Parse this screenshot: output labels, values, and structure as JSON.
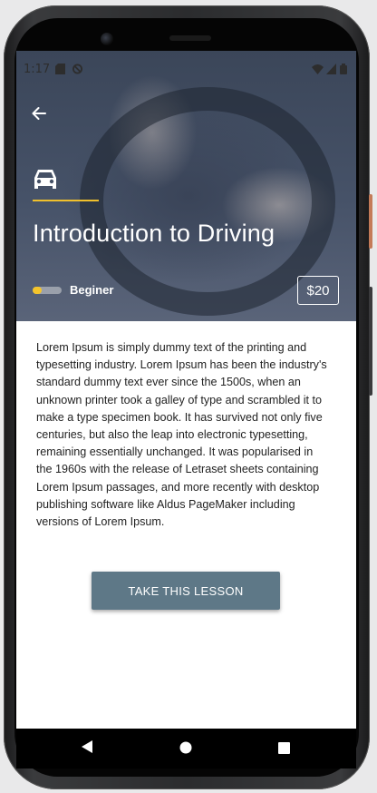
{
  "status_bar": {
    "time": "1:17",
    "icons": [
      "sd-card-icon",
      "do-not-disturb-icon",
      "wifi-icon",
      "signal-icon",
      "battery-icon"
    ]
  },
  "lesson": {
    "icon": "car-icon",
    "title": "Introduction to Driving",
    "level_label": "Beginer",
    "level_fraction": 0.3,
    "price": "$20",
    "description": "Lorem Ipsum is simply dummy text of the printing and typesetting industry. Lorem Ipsum has been the industry's standard dummy text ever since the 1500s, when an unknown printer took a galley of type and scrambled it to make a type specimen book. It has survived not only five centuries, but also the leap into electronic typesetting, remaining essentially unchanged. It was popularised in the 1960s with the release of Letraset sheets containing Lorem Ipsum passages, and more recently with desktop publishing software like Aldus PageMaker including versions of Lorem Ipsum.",
    "cta_label": "TAKE THIS LESSON"
  },
  "navigation": {
    "back_icon": "arrow-left-icon",
    "system_buttons": [
      "back-triangle-icon",
      "home-circle-icon",
      "recents-square-icon"
    ]
  },
  "colors": {
    "accent": "#f0c02c",
    "button": "#5e7887",
    "hero_overlay": "#465268"
  }
}
